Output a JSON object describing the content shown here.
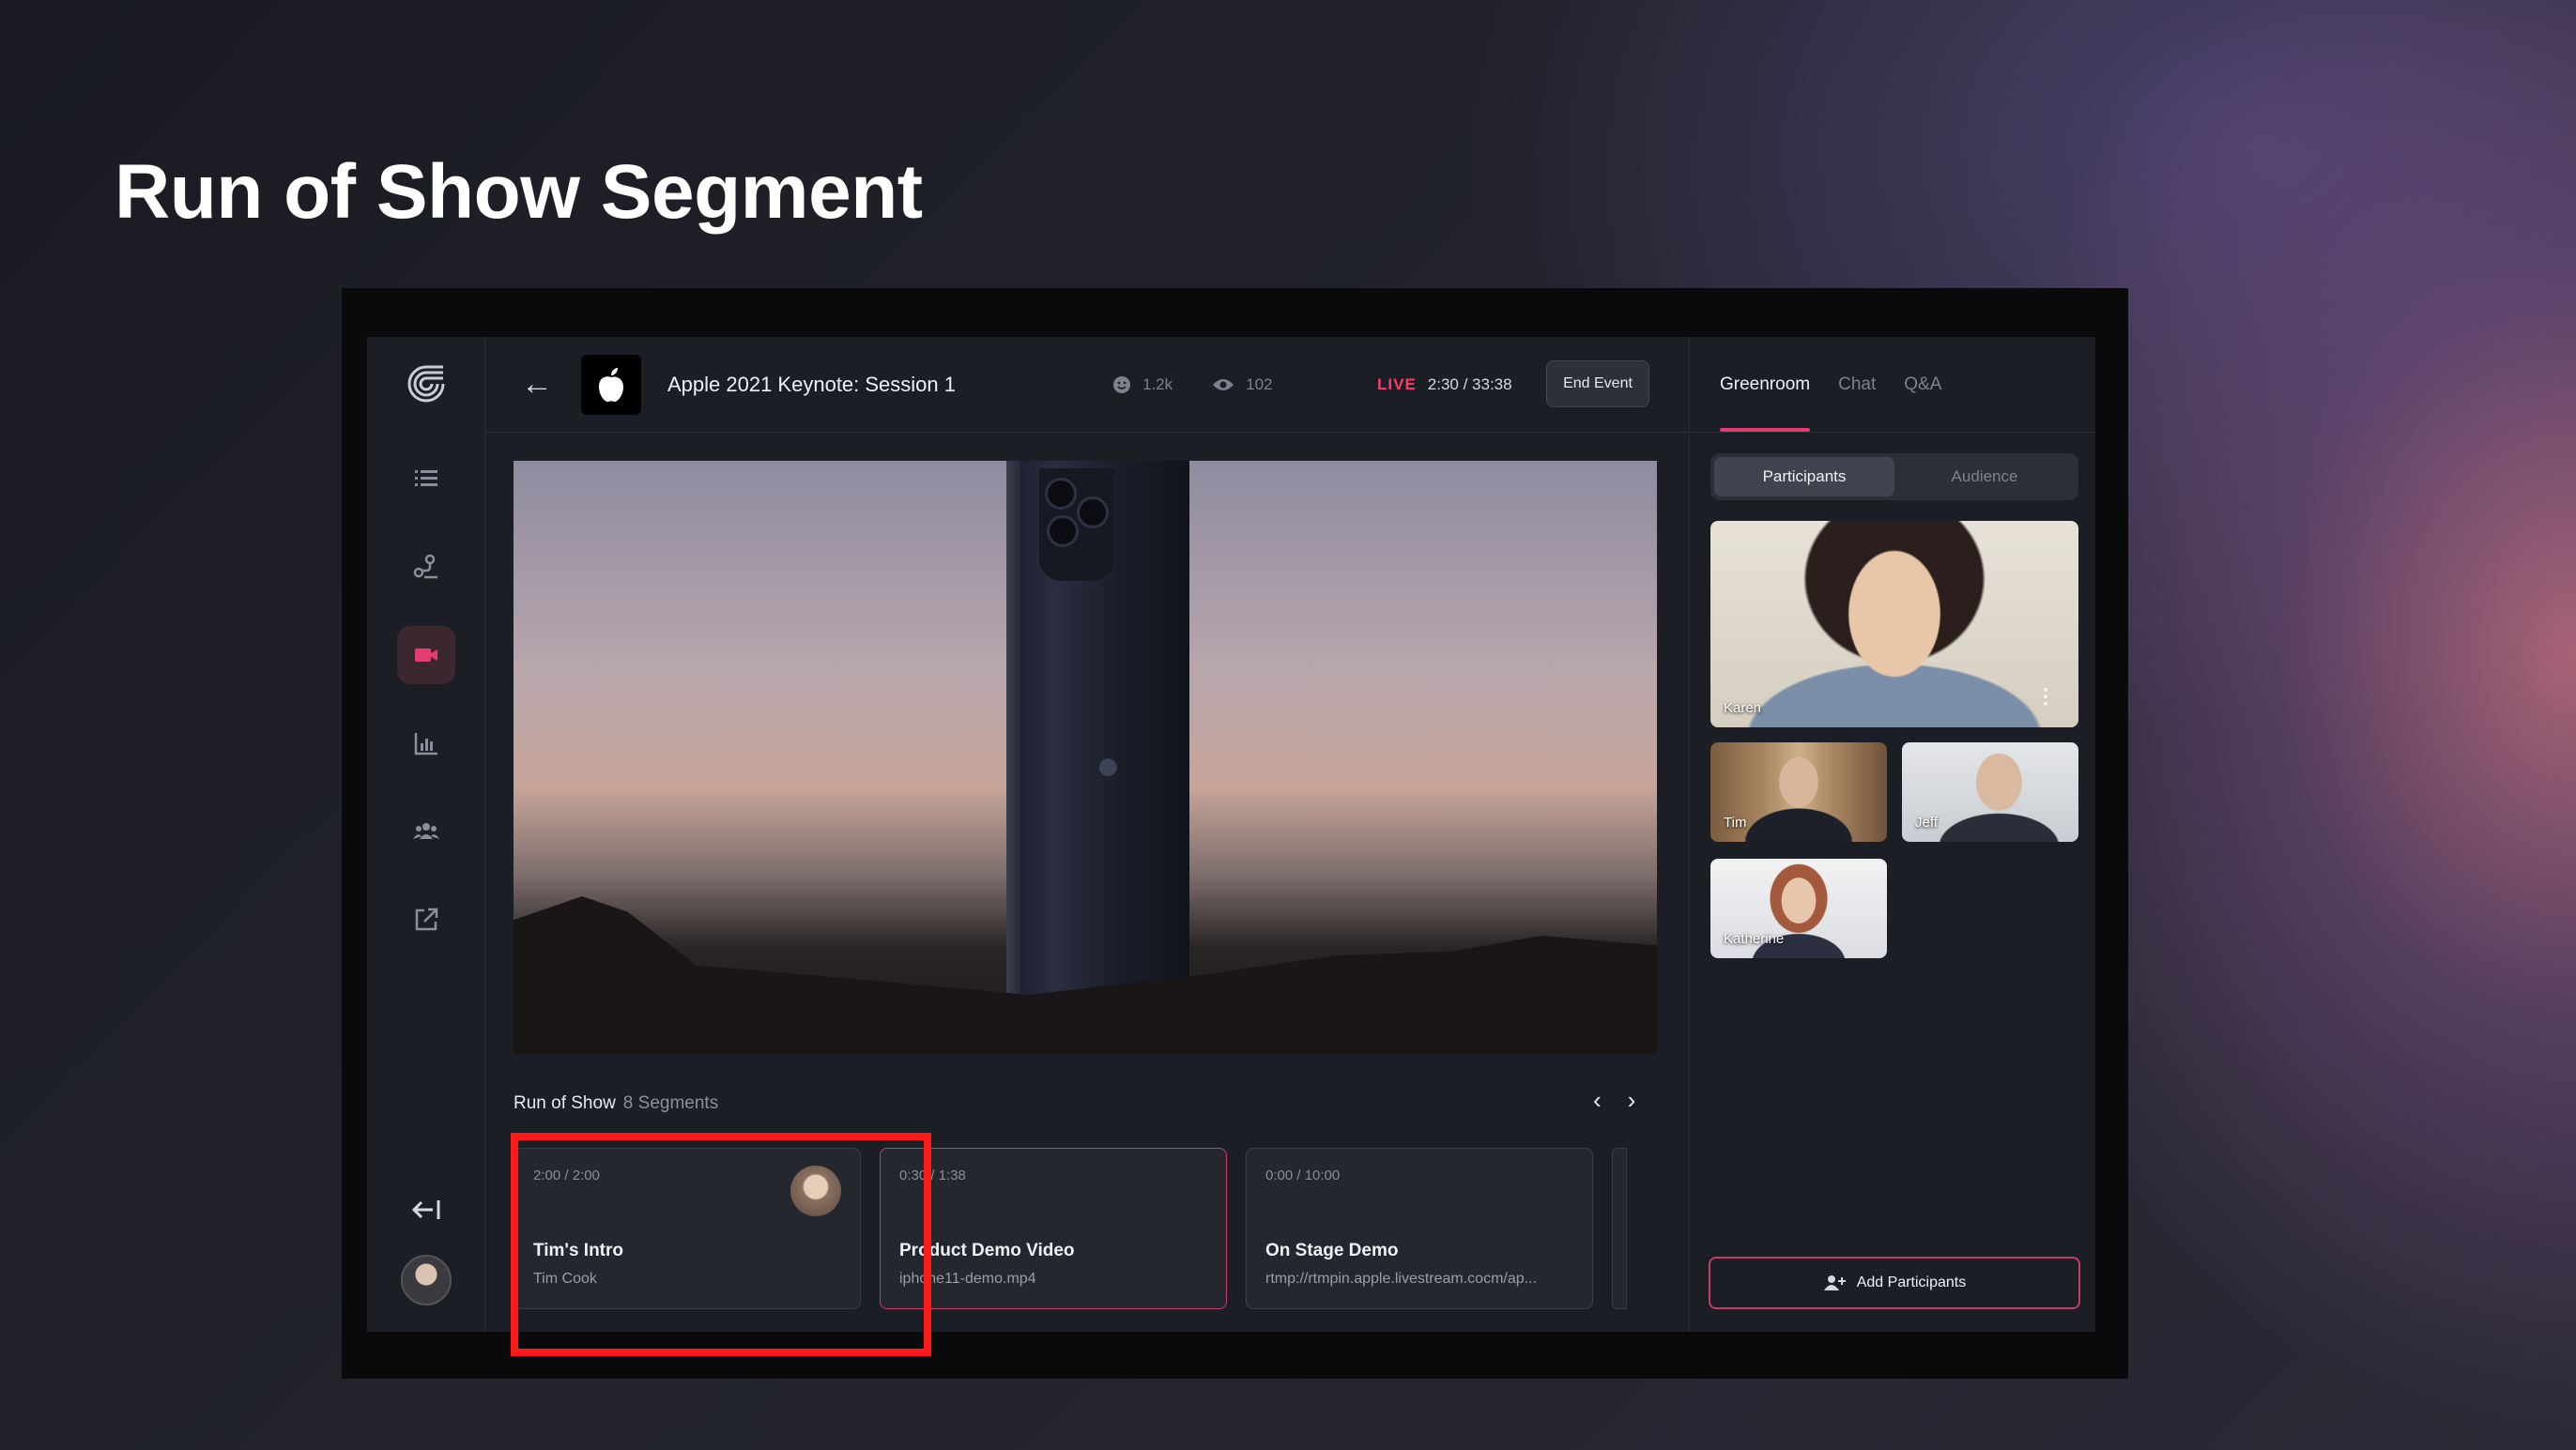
{
  "slide": {
    "title": "Run of Show Segment"
  },
  "topbar": {
    "event_title": "Apple 2021 Keynote: Session 1",
    "reactions": "1.2k",
    "viewers": "102",
    "live_label": "LIVE",
    "live_time": "2:30 / 33:38",
    "end_button": "End Event"
  },
  "sidebar": {
    "items": [
      {
        "icon": "list-icon"
      },
      {
        "icon": "flow-icon"
      },
      {
        "icon": "video-camera-icon",
        "active": true
      },
      {
        "icon": "analytics-icon"
      },
      {
        "icon": "people-icon"
      },
      {
        "icon": "external-link-icon"
      }
    ],
    "collapse_icon": "collapse-left-icon"
  },
  "run_of_show": {
    "label": "Run of Show",
    "count": "8 Segments",
    "segments": [
      {
        "time": "2:00 / 2:00",
        "title": "Tim's Intro",
        "subtitle": "Tim Cook"
      },
      {
        "time": "0:30 / 1:38",
        "title": "Product Demo Video",
        "subtitle": "iphone11-demo.mp4"
      },
      {
        "time": "0:00 / 10:00",
        "title": "On Stage Demo",
        "subtitle": "rtmp://rtmpin.apple.livestream.cocm/ap..."
      }
    ]
  },
  "right_panel": {
    "tabs": [
      "Greenroom",
      "Chat",
      "Q&A"
    ],
    "segment_buttons": [
      "Participants",
      "Audience"
    ],
    "participants": [
      "Karen",
      "Tim",
      "Jeff",
      "Katherine"
    ],
    "add_button": "Add Participants"
  },
  "colors": {
    "accent": "#e33d6f",
    "live": "#ff3b6a",
    "highlight": "#ff1a1a",
    "panel_bg": "#1c1e25"
  }
}
